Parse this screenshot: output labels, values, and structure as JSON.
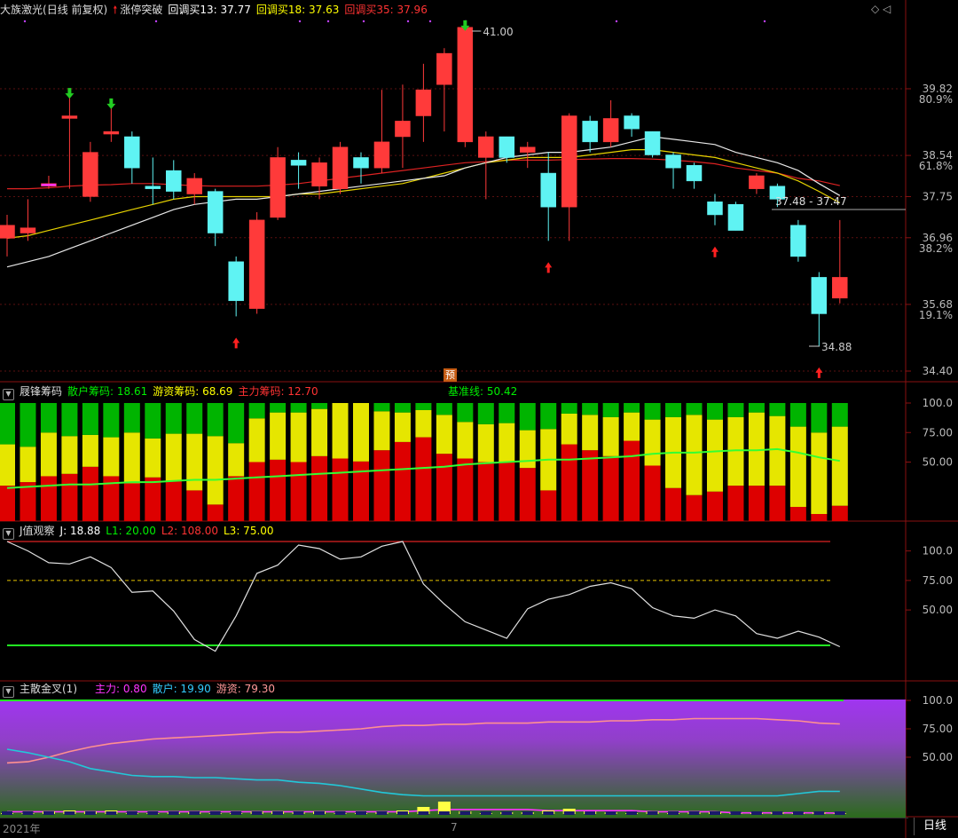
{
  "title": {
    "name": "大族激光",
    "mode": "(日线 前复权)",
    "signal": "涨停突破",
    "ma": [
      {
        "label": "回调买13: 37.77",
        "color": "#ffffff"
      },
      {
        "label": "回调买18: 37.63",
        "color": "#ffff00"
      },
      {
        "label": "回调买35: 37.96",
        "color": "#ff3333"
      }
    ]
  },
  "panels": {
    "chip": {
      "name": "屐锋筹码",
      "items": [
        {
          "label": "散户筹码: 18.61",
          "color": "#00ee00"
        },
        {
          "label": "游资筹码: 68.69",
          "color": "#ffff00"
        },
        {
          "label": "主力筹码: 12.70",
          "color": "#ff3333"
        }
      ],
      "base": "基准线: 50.42"
    },
    "j": {
      "name": "J值观察",
      "items": [
        {
          "label": "J: 18.88",
          "color": "#ffffff"
        },
        {
          "label": "L1: 20.00",
          "color": "#00ee00"
        },
        {
          "label": "L2: 108.00",
          "color": "#ff3333"
        },
        {
          "label": "L3: 75.00",
          "color": "#ffff00"
        }
      ]
    },
    "cross": {
      "name": "主散金叉(1)",
      "items": [
        {
          "label": "主力: 0.80",
          "color": "#ff33ff"
        },
        {
          "label": "散户: 19.90",
          "color": "#33ccff"
        },
        {
          "label": "游资: 79.30",
          "color": "#ff9999"
        }
      ]
    }
  },
  "labels": {
    "badge": "预",
    "tab": "日线",
    "year": "2021年",
    "month": "7",
    "corner": "◇ ◁"
  },
  "price_axis": {
    "ticks": [
      "39.82",
      "38.54",
      "37.75",
      "36.96",
      "35.68",
      "34.40"
    ],
    "pct": [
      "80.9%",
      "61.8%",
      "38.2%",
      "19.1%"
    ]
  },
  "chip_axis": [
    "100.0",
    "75.00",
    "50.00"
  ],
  "j_axis": [
    "100.0",
    "75.00",
    "50.00"
  ],
  "cross_axis": [
    "100.0",
    "75.00",
    "50.00"
  ],
  "annotations": {
    "high": "41.00",
    "low": "34.88",
    "fib": "37.48 - 37.47"
  },
  "chart_data": {
    "type": "candlestick",
    "candles": [
      {
        "o": 36.95,
        "c": 37.2,
        "h": 37.4,
        "l": 36.6
      },
      {
        "o": 37.05,
        "c": 37.15,
        "h": 37.7,
        "l": 36.9
      },
      {
        "o": 37.95,
        "c": 38.0,
        "h": 38.15,
        "l": 37.9
      },
      {
        "o": 39.25,
        "c": 39.3,
        "h": 39.8,
        "l": 37.9
      },
      {
        "o": 37.75,
        "c": 38.6,
        "h": 38.8,
        "l": 37.65
      },
      {
        "o": 38.95,
        "c": 39.0,
        "h": 39.6,
        "l": 38.8
      },
      {
        "o": 38.9,
        "c": 38.3,
        "h": 39.0,
        "l": 38.0
      },
      {
        "o": 37.95,
        "c": 37.9,
        "h": 38.5,
        "l": 37.6
      },
      {
        "o": 38.25,
        "c": 37.85,
        "h": 38.45,
        "l": 37.7
      },
      {
        "o": 37.8,
        "c": 38.1,
        "h": 38.2,
        "l": 37.6
      },
      {
        "o": 37.85,
        "c": 37.05,
        "h": 37.9,
        "l": 36.8
      },
      {
        "o": 36.5,
        "c": 35.75,
        "h": 36.6,
        "l": 35.45
      },
      {
        "o": 35.6,
        "c": 37.3,
        "h": 37.45,
        "l": 35.5
      },
      {
        "o": 37.35,
        "c": 38.5,
        "h": 38.7,
        "l": 37.3
      },
      {
        "o": 38.45,
        "c": 38.35,
        "h": 38.6,
        "l": 37.9
      },
      {
        "o": 37.95,
        "c": 38.4,
        "h": 38.5,
        "l": 37.7
      },
      {
        "o": 37.9,
        "c": 38.7,
        "h": 38.8,
        "l": 37.8
      },
      {
        "o": 38.5,
        "c": 38.3,
        "h": 38.6,
        "l": 38.0
      },
      {
        "o": 38.3,
        "c": 38.8,
        "h": 39.8,
        "l": 38.2
      },
      {
        "o": 38.9,
        "c": 39.2,
        "h": 39.9,
        "l": 38.3
      },
      {
        "o": 39.3,
        "c": 39.8,
        "h": 40.3,
        "l": 38.8
      },
      {
        "o": 39.9,
        "c": 40.5,
        "h": 40.6,
        "l": 39.0
      },
      {
        "o": 38.8,
        "c": 41.0,
        "h": 41.1,
        "l": 38.7
      },
      {
        "o": 38.5,
        "c": 38.9,
        "h": 39.0,
        "l": 37.7
      },
      {
        "o": 38.9,
        "c": 38.5,
        "h": 38.9,
        "l": 38.4
      },
      {
        "o": 38.6,
        "c": 38.7,
        "h": 38.8,
        "l": 38.3
      },
      {
        "o": 38.2,
        "c": 37.55,
        "h": 38.6,
        "l": 36.9
      },
      {
        "o": 37.55,
        "c": 39.3,
        "h": 39.35,
        "l": 36.9
      },
      {
        "o": 39.2,
        "c": 38.8,
        "h": 39.3,
        "l": 38.6
      },
      {
        "o": 38.8,
        "c": 39.25,
        "h": 39.6,
        "l": 38.7
      },
      {
        "o": 39.3,
        "c": 39.05,
        "h": 39.35,
        "l": 38.9
      },
      {
        "o": 39.0,
        "c": 38.55,
        "h": 39.0,
        "l": 38.5
      },
      {
        "o": 38.55,
        "c": 38.3,
        "h": 38.6,
        "l": 37.9
      },
      {
        "o": 38.35,
        "c": 38.05,
        "h": 38.4,
        "l": 37.9
      },
      {
        "o": 37.65,
        "c": 37.4,
        "h": 37.8,
        "l": 37.2
      },
      {
        "o": 37.6,
        "c": 37.1,
        "h": 37.65,
        "l": 37.1
      },
      {
        "o": 37.9,
        "c": 38.15,
        "h": 38.2,
        "l": 37.8
      },
      {
        "o": 37.95,
        "c": 37.7,
        "h": 38.0,
        "l": 37.55
      },
      {
        "o": 37.2,
        "c": 36.6,
        "h": 37.3,
        "l": 36.5
      },
      {
        "o": 36.2,
        "c": 35.5,
        "h": 36.3,
        "l": 34.88
      },
      {
        "o": 35.8,
        "c": 36.2,
        "h": 37.3,
        "l": 35.7
      }
    ],
    "ma13": [
      36.4,
      36.5,
      36.6,
      36.75,
      36.9,
      37.05,
      37.2,
      37.35,
      37.5,
      37.6,
      37.65,
      37.7,
      37.7,
      37.75,
      37.8,
      37.85,
      37.9,
      37.95,
      38.0,
      38.05,
      38.1,
      38.15,
      38.3,
      38.4,
      38.5,
      38.55,
      38.6,
      38.6,
      38.65,
      38.7,
      38.8,
      38.9,
      38.85,
      38.8,
      38.75,
      38.6,
      38.5,
      38.4,
      38.25,
      38.0,
      37.77
    ],
    "ma18": [
      36.95,
      37.0,
      37.1,
      37.2,
      37.3,
      37.4,
      37.5,
      37.6,
      37.7,
      37.75,
      37.75,
      37.75,
      37.75,
      37.75,
      37.8,
      37.8,
      37.85,
      37.9,
      37.95,
      38.0,
      38.1,
      38.2,
      38.3,
      38.4,
      38.45,
      38.5,
      38.5,
      38.5,
      38.55,
      38.6,
      38.65,
      38.65,
      38.6,
      38.55,
      38.5,
      38.4,
      38.3,
      38.2,
      38.05,
      37.85,
      37.63
    ],
    "ma35": [
      37.9,
      37.9,
      37.92,
      37.95,
      37.97,
      37.98,
      38.0,
      38.0,
      37.98,
      37.96,
      37.95,
      37.95,
      37.95,
      37.97,
      38.0,
      38.05,
      38.1,
      38.15,
      38.2,
      38.25,
      38.3,
      38.35,
      38.4,
      38.42,
      38.45,
      38.45,
      38.45,
      38.46,
      38.47,
      38.48,
      38.48,
      38.47,
      38.45,
      38.42,
      38.38,
      38.3,
      38.25,
      38.2,
      38.1,
      38.05,
      37.96
    ],
    "up_arrows": [
      11,
      26,
      34,
      39
    ],
    "buy_down_arrows": [
      3,
      5,
      22
    ],
    "chip": {
      "red": [
        30,
        33,
        38,
        40,
        46,
        38,
        32,
        37,
        34,
        26,
        14,
        38,
        50,
        52,
        50,
        55,
        53,
        51,
        60,
        67,
        71,
        57,
        53,
        50,
        50,
        45,
        26,
        65,
        60,
        55,
        68,
        47,
        28,
        22,
        25,
        30,
        30,
        30,
        12,
        6,
        13
      ],
      "yellow": [
        35,
        30,
        37,
        32,
        27,
        33,
        43,
        33,
        40,
        48,
        58,
        28,
        37,
        40,
        42,
        40,
        47,
        50,
        33,
        25,
        23,
        33,
        31,
        32,
        33,
        32,
        52,
        26,
        30,
        33,
        24,
        39,
        60,
        68,
        61,
        58,
        62,
        59,
        68,
        69,
        67
      ],
      "green": [
        35,
        37,
        25,
        28,
        27,
        29,
        25,
        30,
        26,
        26,
        28,
        34,
        13,
        8,
        8,
        5,
        0,
        0,
        7,
        8,
        6,
        10,
        16,
        18,
        17,
        23,
        22,
        9,
        10,
        12,
        8,
        14,
        12,
        10,
        14,
        12,
        8,
        11,
        20,
        25,
        20
      ],
      "base": [
        28,
        29,
        30,
        31,
        31,
        32,
        33,
        33,
        34,
        35,
        35,
        36,
        37,
        38,
        39,
        40,
        41,
        42,
        43,
        44,
        45,
        46,
        48,
        49,
        50,
        51,
        52,
        52,
        53,
        54,
        55,
        57,
        58,
        58,
        59,
        60,
        60,
        61,
        58,
        54,
        51
      ]
    },
    "j": [
      108,
      100,
      90,
      89,
      95,
      86,
      65,
      66,
      49,
      25,
      15,
      45,
      81,
      88,
      105,
      102,
      93,
      95,
      104,
      108,
      72,
      55,
      40,
      33,
      26,
      51,
      59,
      63,
      70,
      73,
      68,
      52,
      45,
      43,
      50,
      45,
      30,
      26,
      32,
      27,
      18.88
    ],
    "cross": {
      "main": [
        2,
        2,
        2,
        2,
        2,
        2,
        2,
        2,
        2,
        2,
        2,
        2,
        2,
        2,
        2,
        2,
        2,
        2,
        2,
        2,
        3,
        4,
        4,
        4,
        4,
        4,
        3,
        3,
        3,
        3,
        3,
        2,
        2,
        2,
        2,
        1,
        1,
        1,
        1,
        1,
        0.8
      ],
      "retail": [
        57,
        54,
        50,
        46,
        40,
        37,
        34,
        33,
        33,
        32,
        32,
        31,
        30,
        30,
        28,
        27,
        25,
        22,
        19,
        17,
        16,
        16,
        16,
        16,
        16,
        16,
        16,
        16,
        16,
        16,
        16,
        16,
        16,
        16,
        16,
        16,
        16,
        16,
        18,
        20,
        19.9
      ],
      "hot": [
        45,
        46,
        50,
        55,
        59,
        62,
        64,
        66,
        67,
        68,
        69,
        70,
        71,
        72,
        72,
        73,
        74,
        75,
        77,
        78,
        78,
        79,
        79,
        80,
        80,
        80,
        81,
        81,
        81,
        82,
        82,
        83,
        83,
        84,
        84,
        84,
        84,
        83,
        82,
        80,
        79.3
      ],
      "vol": [
        1,
        1,
        3,
        4,
        3,
        4,
        1,
        1,
        2,
        2,
        1,
        1,
        3,
        3,
        2,
        3,
        1,
        1,
        2,
        4,
        8,
        14,
        3,
        1,
        2,
        2,
        4,
        6,
        3,
        2,
        1,
        3,
        1,
        2,
        2,
        1,
        1,
        2,
        1,
        2,
        1
      ]
    }
  }
}
